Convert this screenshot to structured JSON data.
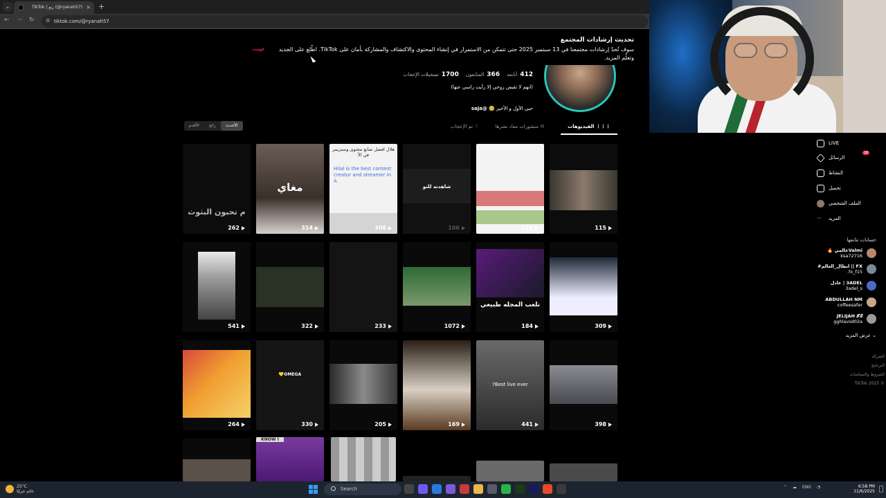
{
  "browser": {
    "tab_title": "TikTok | ريو (@ryanah57)",
    "tab_close": "×",
    "new_tab": "+",
    "url": "tiktok.com/@ryanah57",
    "nav_back": "←",
    "nav_forward": "→",
    "nav_reload": "↻"
  },
  "notice": {
    "title": "تحديث إرشادات المجتمع",
    "body": "سوف تُحدّ إرشادات مجتمعنا في 13 سبتمبر 2025 حتى تتمكن من الاستمرار في إنشاء المحتوى والاكتشاف والمشاركة بأمان على TikTok. اطّلع على الجديد وتعلّم المزيد.",
    "dismiss": "فهمت"
  },
  "profile": {
    "stats": [
      {
        "value": "412",
        "label": "أتابعه"
      },
      {
        "value": "366",
        "label": "المتابعون"
      },
      {
        "value": "1700",
        "label": "تسجيلات الإعجاب"
      }
    ],
    "bio_line1": "(انهم لا تقبض روحي إلا رأيت راسي عنها)",
    "bio_line2_prefix": "حبي الأول و الأخير 🥺 ",
    "bio_mention": "@saja"
  },
  "tabs": [
    {
      "label": "الفيديوهات",
      "icon": "videos-grid-icon"
    },
    {
      "label": "منشورات معاد نشرها",
      "icon": "repost-icon"
    },
    {
      "label": "تم الإعجاب",
      "icon": "liked-icon"
    }
  ],
  "sort": [
    "الأحدث",
    "رائج",
    "الأقدم"
  ],
  "videos": [
    {
      "views": "262",
      "caption": "م تحبون البثوث"
    },
    {
      "views": "314",
      "caption": "مغاي"
    },
    {
      "views": "306",
      "caption": "هلال افضل صانع محتوى وستريمر في الأ"
    },
    {
      "views": "106",
      "caption": "شاهدنه للنو"
    },
    {
      "views": "126",
      "caption": ""
    },
    {
      "views": "115",
      "caption": ""
    },
    {
      "views": "541",
      "caption": ""
    },
    {
      "views": "322",
      "caption": ""
    },
    {
      "views": "233",
      "caption": ""
    },
    {
      "views": "1072",
      "caption": ""
    },
    {
      "views": "184",
      "caption": "نلعب المجله طبيعي"
    },
    {
      "views": "309",
      "caption": ""
    },
    {
      "views": "264",
      "caption": ""
    },
    {
      "views": "330",
      "caption": "OMEGA💛"
    },
    {
      "views": "205",
      "caption": ""
    },
    {
      "views": "169",
      "caption": ""
    },
    {
      "views": "441",
      "caption": "Best live ever?"
    },
    {
      "views": "398",
      "caption": ""
    },
    {
      "views": "",
      "caption": ""
    },
    {
      "views": "",
      "caption": "KNOW I"
    },
    {
      "views": "",
      "caption": ""
    },
    {
      "views": "",
      "caption": ""
    },
    {
      "views": "",
      "caption": ""
    },
    {
      "views": "",
      "caption": ""
    }
  ],
  "video_extra": {
    "hilal_text": "Hilal is the best content creator and streamer in A",
    "omega_label": "OMEGA💛"
  },
  "sidebar": {
    "items": [
      {
        "label": "LIVE",
        "icon": "live-icon"
      },
      {
        "label": "الرسائل",
        "icon": "messages-icon",
        "badge": "18"
      },
      {
        "label": "النشاط",
        "icon": "activity-icon"
      },
      {
        "label": "تحميل",
        "icon": "upload-icon"
      },
      {
        "label": "الملف الشخصي",
        "icon": "profile-icon"
      },
      {
        "label": "المزيد",
        "icon": "more-icon"
      }
    ],
    "following_title": "حسابات تتابعها",
    "following": [
      {
        "name": "Valmiعالمي 🔥",
        "handle": "ksa72716"
      },
      {
        "name": "FX || ابطال_العالم#",
        "handle": "fx_f15."
      },
      {
        "name": "3ADEL | عادل",
        "handle": "3adel_s"
      },
      {
        "name": "ABDULLAH NM",
        "handle": "coffeesafer"
      },
      {
        "name": "JELIJAH 𝓣𝓔",
        "handle": "gghlavsd02a"
      }
    ],
    "see_more": "عرض المزيد",
    "footer": [
      "الشركة",
      "البرنامج",
      "الشروط والسياسات",
      "© 2025 TikTok"
    ]
  },
  "taskbar": {
    "temp": "25°C",
    "weather": "غائم جزئيًا",
    "search": "Search",
    "lang": "ENG",
    "time": "6:58 PM",
    "date": "11/6/2025"
  }
}
